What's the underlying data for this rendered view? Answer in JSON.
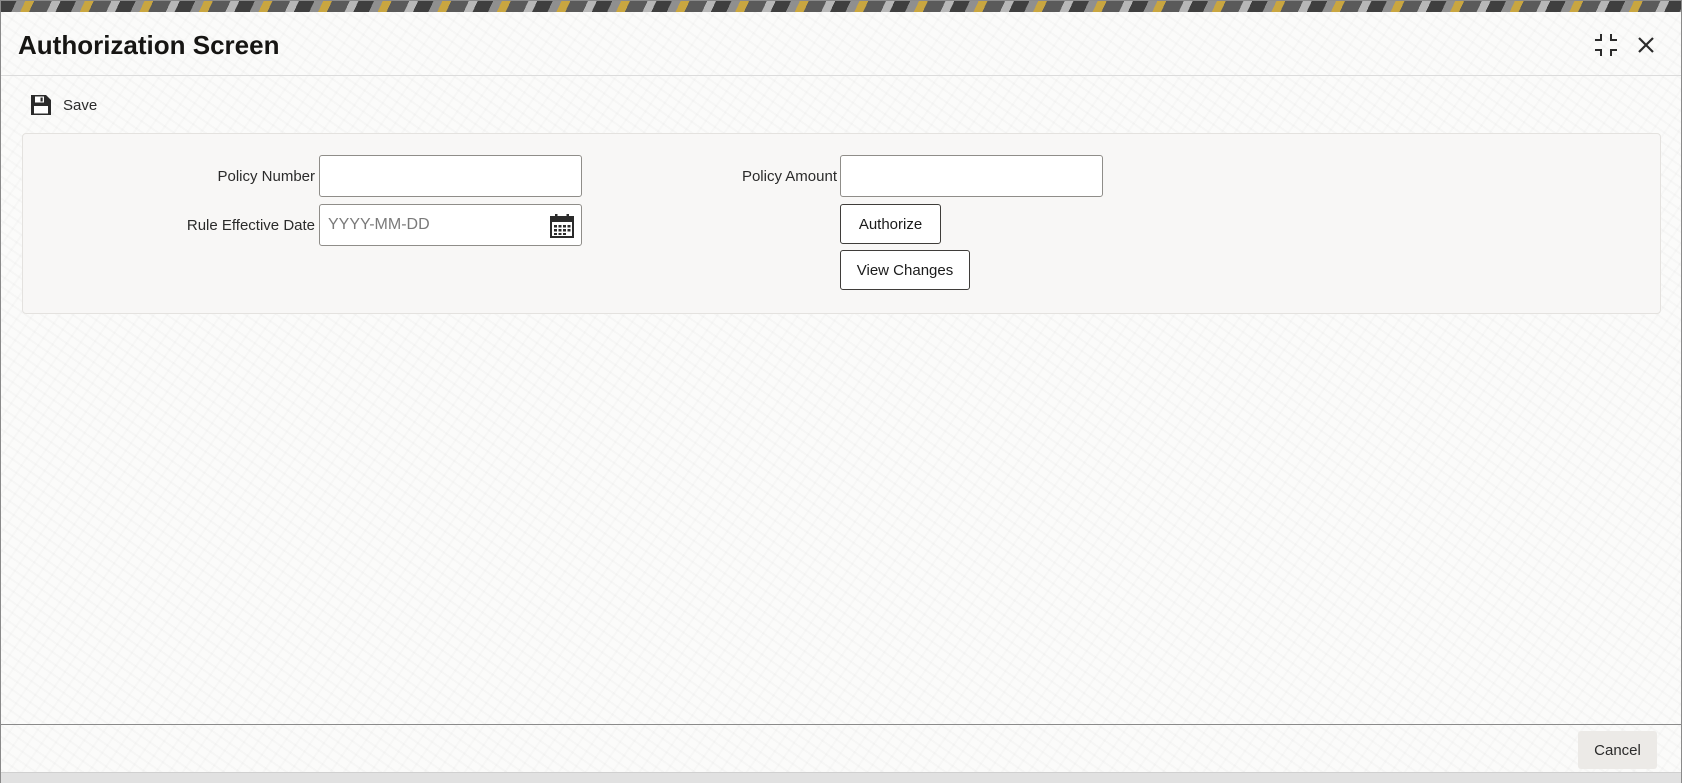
{
  "window": {
    "title": "Authorization Screen"
  },
  "toolbar": {
    "save_label": "Save"
  },
  "form": {
    "policy_number_label": "Policy Number",
    "policy_number_value": "",
    "rule_effective_date_label": "Rule Effective Date",
    "rule_effective_date_placeholder": "YYYY-MM-DD",
    "policy_amount_label": "Policy Amount",
    "policy_amount_value": ""
  },
  "actions": {
    "authorize_label": "Authorize",
    "view_changes_label": "View Changes"
  },
  "footer": {
    "cancel_label": "Cancel"
  },
  "icons": {
    "save": "floppy-disk-icon",
    "calendar": "calendar-icon",
    "minimize": "minimize-icon",
    "close": "close-icon"
  }
}
